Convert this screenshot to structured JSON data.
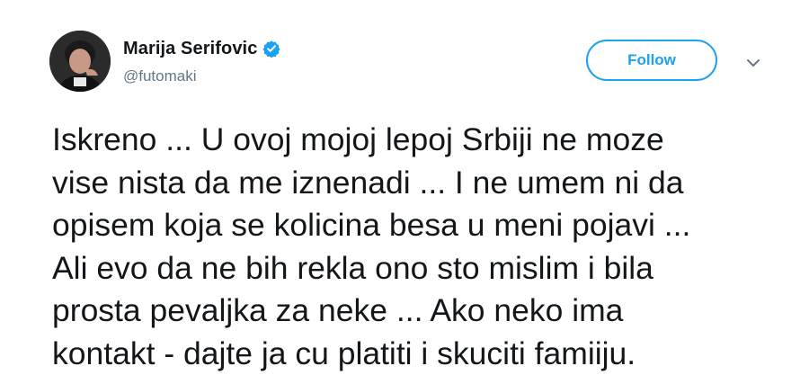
{
  "tweet": {
    "author": {
      "display_name": "Marija Serifovic",
      "handle": "@futomaki",
      "verified": true,
      "avatar_icon": "profile-photo"
    },
    "follow_label": "Follow",
    "menu_icon": "chevron-down-icon",
    "text": "Iskreno ... U ovoj mojoj lepoj Srbiji ne moze\nvise nista da me iznenadi ... I ne umem ni da\nopisem koja se kolicina besa u meni pojavi ...\nAli evo da ne bih rekla ono sto mislim i bila\nprosta pevaljka za neke ... Ako neko ima\nkontakt - dajte ja cu platiti i skuciti famiiju."
  },
  "colors": {
    "accent": "#1da1f2",
    "text_primary": "#14171a",
    "text_secondary": "#657786",
    "caret": "#657786"
  }
}
